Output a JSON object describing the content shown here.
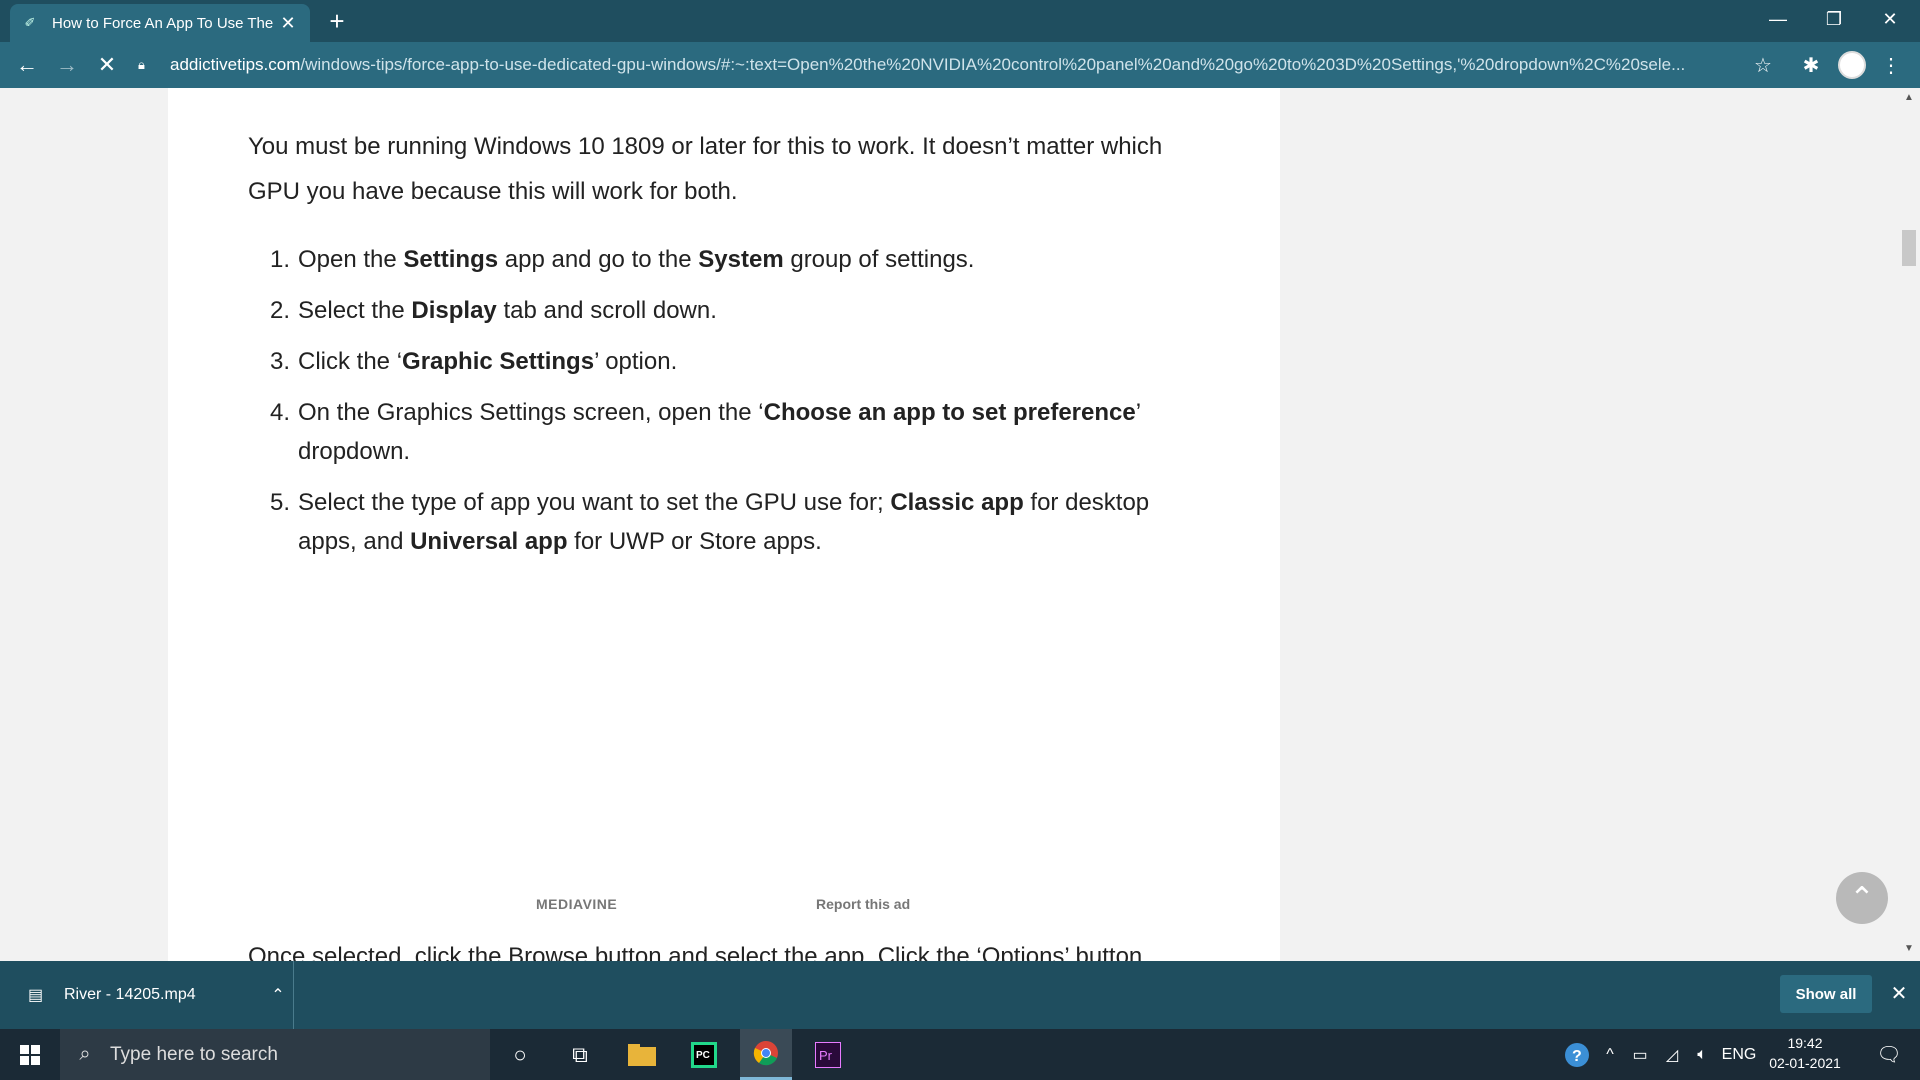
{
  "browser": {
    "tab": {
      "title": "How to Force An App To Use The",
      "close": "✕"
    },
    "new_tab": "+",
    "window_controls": {
      "minimize": "—",
      "restore": "❐",
      "close": "✕"
    },
    "url_host": "addictivetips.com",
    "url_path": "/windows-tips/force-app-to-use-dedicated-gpu-windows/#:~:text=Open%20the%20NVIDIA%20control%20panel%20and%20go%20to%203D%20Settings,'%20dropdown%2C%20sele..."
  },
  "article": {
    "intro": "You must be running Windows 10 1809 or later for this to work. It doesn’t matter which GPU you have because this will work for both.",
    "steps": [
      {
        "num": "1.",
        "parts": [
          "Open the ",
          "Settings",
          " app and go to the ",
          "System",
          " group of settings."
        ]
      },
      {
        "num": "2.",
        "parts": [
          "Select the ",
          "Display",
          " tab and scroll down."
        ]
      },
      {
        "num": "3.",
        "parts": [
          "Click the ‘",
          "Graphic Settings",
          "’ option."
        ]
      },
      {
        "num": "4.",
        "parts": [
          "On the Graphics Settings screen, open the ‘",
          "Choose an app to set preference",
          "’ dropdown."
        ]
      },
      {
        "num": "5.",
        "parts": [
          "Select the type of app you want to set the GPU use for; ",
          "Classic app",
          " for desktop apps, and ",
          "Universal app",
          " for UWP or Store apps."
        ]
      }
    ],
    "ad_brand": "MEDIAVINE",
    "report_ad": "Report this ad",
    "cut_line": "Once selected, click the Browse button and select the app. Click the ‘Options’ button"
  },
  "download_bar": {
    "file_name": "River - 14205.mp4",
    "show_all": "Show all",
    "close": "✕"
  },
  "taskbar": {
    "search_placeholder": "Type here to search",
    "language": "ENG",
    "time": "19:42",
    "date": "02-01-2021"
  }
}
